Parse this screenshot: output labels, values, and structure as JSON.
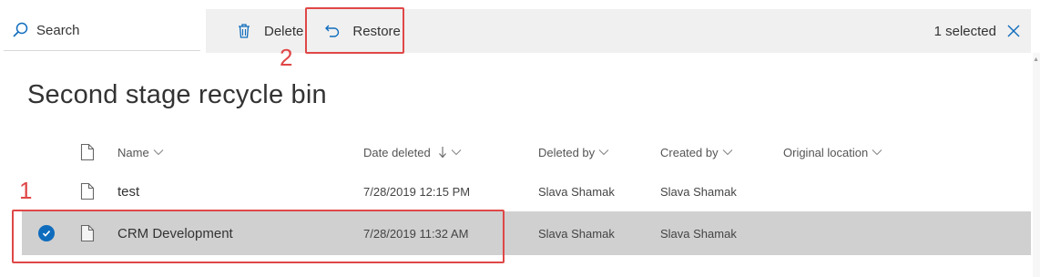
{
  "search": {
    "label": "Search"
  },
  "commandbar": {
    "delete_label": "Delete",
    "restore_label": "Restore",
    "selected_count": "1 selected"
  },
  "annotations": {
    "step_1": "1",
    "step_2": "2"
  },
  "page": {
    "title": "Second stage recycle bin"
  },
  "table": {
    "columns": {
      "name": "Name",
      "date_deleted": "Date deleted",
      "deleted_by": "Deleted by",
      "created_by": "Created by",
      "original_location": "Original location"
    },
    "rows": [
      {
        "name": "test",
        "date_deleted": "7/28/2019 12:15 PM",
        "deleted_by": "Slava Shamak",
        "created_by": "Slava Shamak",
        "original_location": "",
        "selected": false
      },
      {
        "name": "CRM Development",
        "date_deleted": "7/28/2019 11:32 AM",
        "deleted_by": "Slava Shamak",
        "created_by": "Slava Shamak",
        "original_location": "",
        "selected": true
      }
    ]
  },
  "colors": {
    "accent": "#0f6cbd",
    "annotation": "#e04747",
    "selected_row": "#d0d0d0",
    "commandbar": "#f0f0f0"
  }
}
